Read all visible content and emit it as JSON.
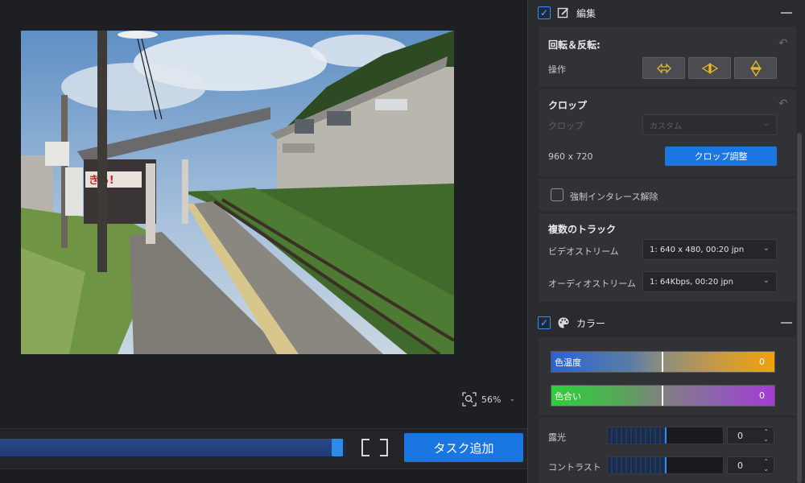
{
  "preview": {
    "zoom_level": "56%",
    "progress_fraction": 0.99
  },
  "bottom_bar": {
    "add_task_label": "タスク追加"
  },
  "edit_section": {
    "title": "編集",
    "rotate_flip": {
      "title": "回転＆反転:",
      "operation_label": "操作"
    },
    "crop": {
      "title": "クロップ",
      "crop_label": "クロップ",
      "crop_value": "カスタム",
      "resolution": "960 x 720",
      "adjust_button": "クロップ調整"
    },
    "deinterlace_label": "強制インタレース解除",
    "tracks": {
      "title": "複数のトラック",
      "video_stream_label": "ビデオストリーム",
      "video_stream_value": "1: 640 x 480,  00:20   jpn",
      "audio_stream_label": "オーディオストリーム",
      "audio_stream_value": "1: 64Kbps,  00:20   jpn"
    }
  },
  "color_section": {
    "title": "カラー",
    "color_temp": {
      "label": "色温度",
      "value": "0"
    },
    "tint": {
      "label": "色合い",
      "value": "0"
    },
    "exposure": {
      "label": "露光",
      "value": "0",
      "level": 0.5
    },
    "contrast": {
      "label": "コントラスト",
      "value": "0",
      "level": 0.5
    }
  },
  "colors": {
    "accent_blue": "#1a76e0",
    "flip_icon_yellow": "#e5b82c"
  }
}
